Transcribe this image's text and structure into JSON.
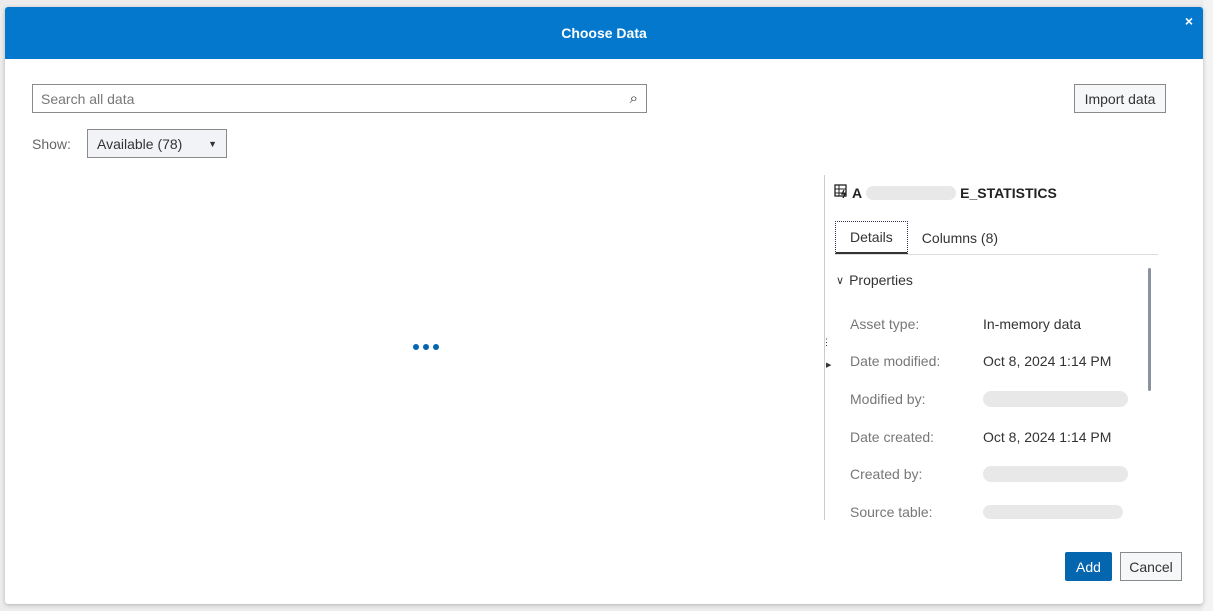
{
  "dialog": {
    "title": "Choose Data",
    "close_icon": "×"
  },
  "search": {
    "placeholder": "Search all data",
    "value": ""
  },
  "import_label": "Import data",
  "show": {
    "label": "Show:",
    "selected": "Available (78)"
  },
  "panel": {
    "table_name_prefix": "A",
    "table_name_suffix": "E_STATISTICS",
    "tabs": [
      {
        "label": "Details",
        "active": true
      },
      {
        "label": "Columns (8)",
        "active": false
      }
    ],
    "section": "Properties",
    "properties": [
      {
        "key": "Asset type:",
        "value": "In-memory data"
      },
      {
        "key": "Date modified:",
        "value": "Oct 8, 2024 1:14 PM"
      },
      {
        "key": "Modified by:",
        "value": null
      },
      {
        "key": "Date created:",
        "value": "Oct 8, 2024 1:14 PM"
      },
      {
        "key": "Created by:",
        "value": null
      },
      {
        "key": "Source table:",
        "value": null
      }
    ]
  },
  "footer": {
    "add": "Add",
    "cancel": "Cancel"
  },
  "colors": {
    "header": "#0378cd",
    "primary": "#0566b0"
  }
}
